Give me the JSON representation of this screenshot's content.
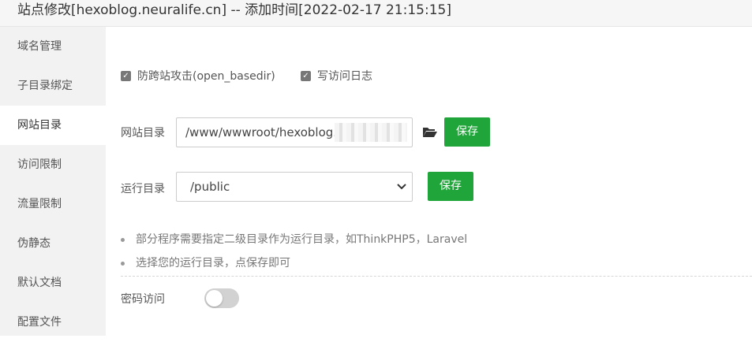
{
  "window": {
    "title": "站点修改[hexoblog.neuralife.cn] -- 添加时间[2022-02-17 21:15:15]"
  },
  "sidebar": {
    "active_index": 2,
    "items": [
      {
        "label": "域名管理"
      },
      {
        "label": "子目录绑定"
      },
      {
        "label": "网站目录"
      },
      {
        "label": "访问限制"
      },
      {
        "label": "流量限制"
      },
      {
        "label": "伪静态"
      },
      {
        "label": "默认文档"
      },
      {
        "label": "配置文件"
      }
    ]
  },
  "options": {
    "anti_xss": {
      "label": "防跨站攻击(open_basedir)",
      "checked": true
    },
    "access_log": {
      "label": "写访问日志",
      "checked": true
    }
  },
  "site_dir": {
    "label": "网站目录",
    "value": "/www/wwwroot/hexoblog.",
    "browse_icon": "folder-open-icon",
    "save_label": "保存"
  },
  "run_dir": {
    "label": "运行目录",
    "selected": "/public",
    "save_label": "保存"
  },
  "tips": [
    "部分程序需要指定二级目录作为运行目录，如ThinkPHP5，Laravel",
    "选择您的运行目录，点保存即可"
  ],
  "password_access": {
    "label": "密码访问",
    "enabled": false
  },
  "colors": {
    "accent": "#20a53a",
    "sidebar_bg": "#f2f2f2",
    "titlebar_bg": "#f6f6f6"
  }
}
